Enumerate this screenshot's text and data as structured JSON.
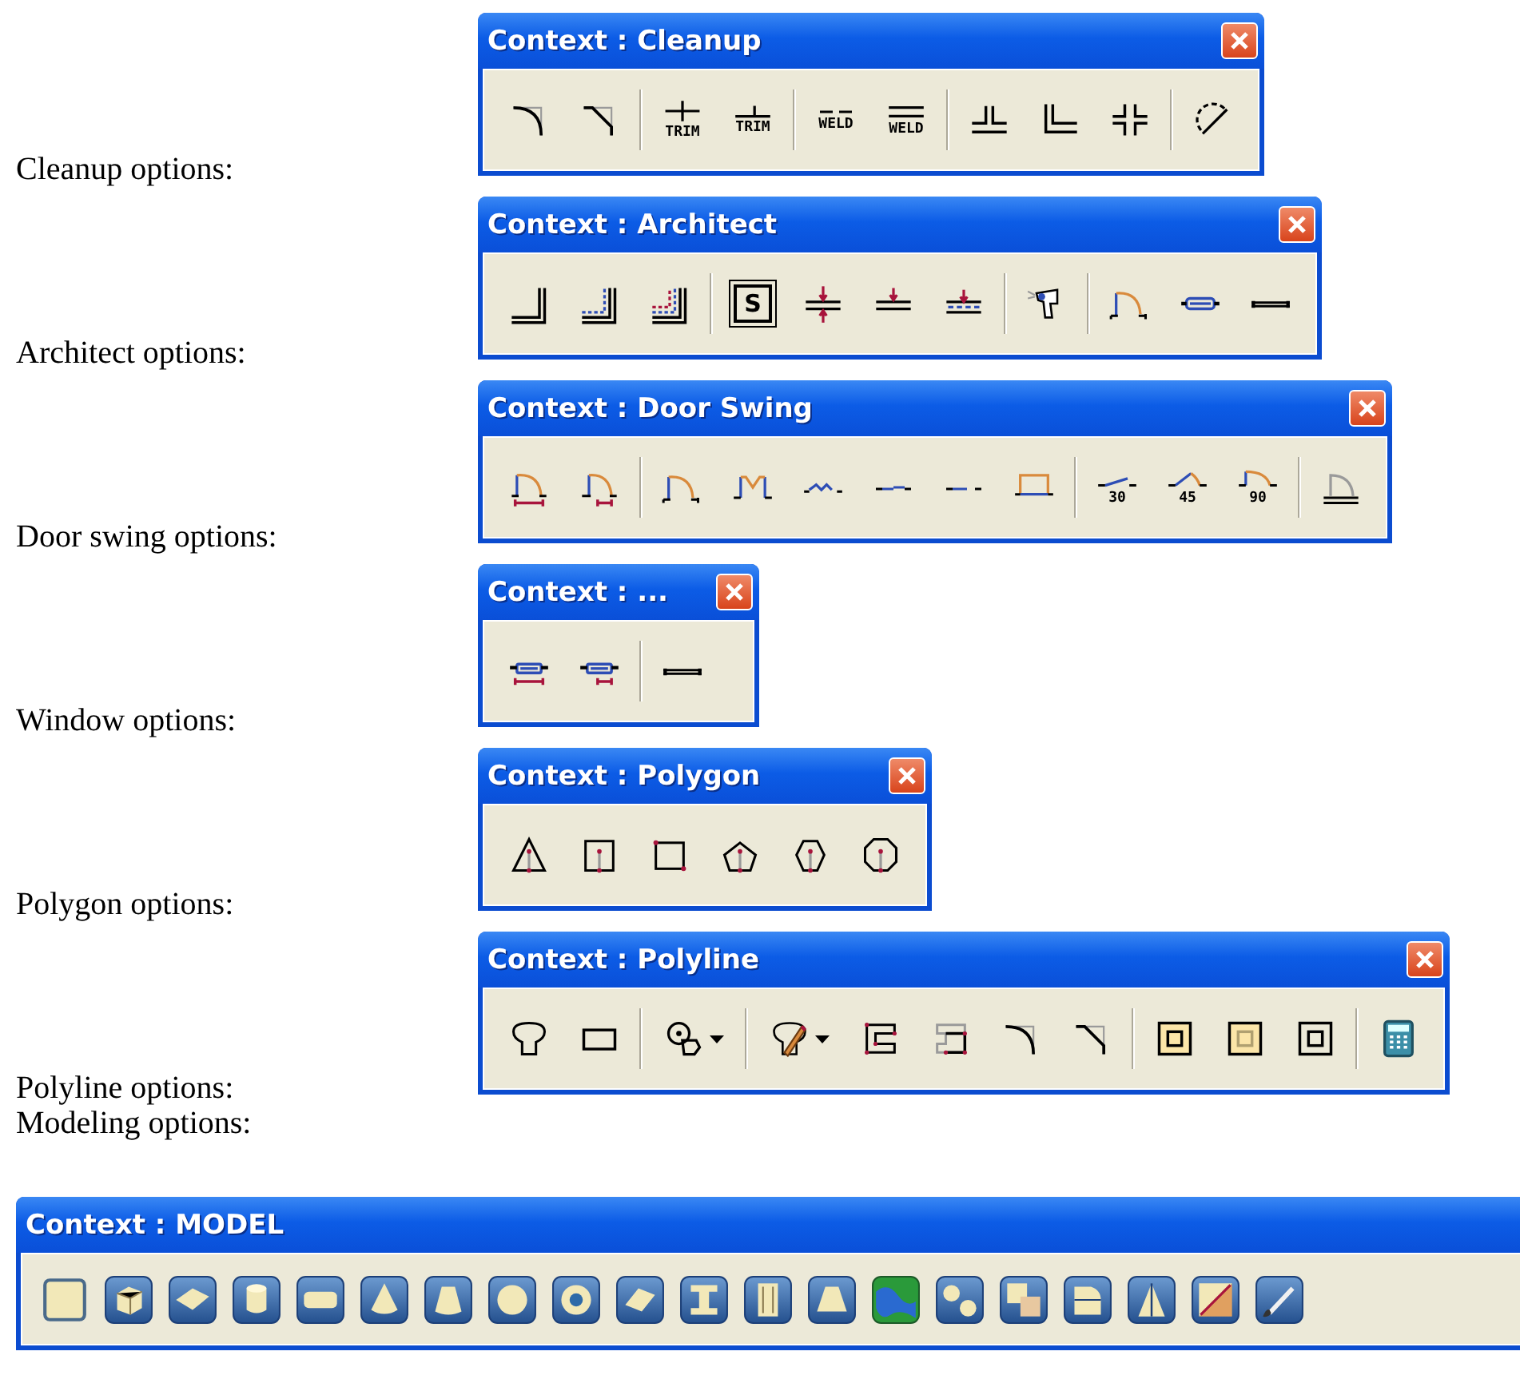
{
  "sections": [
    {
      "kind": "side",
      "label": "Cleanup options:",
      "toolbar": {
        "title": "Context : Cleanup",
        "close_button": true,
        "groups": [
          [
            {
              "kind": "fillet"
            },
            {
              "kind": "chamfer"
            }
          ],
          [
            {
              "kind": "trim-cross",
              "caption": "TRIM"
            },
            {
              "kind": "trim-tee",
              "caption": "TRIM"
            }
          ],
          [
            {
              "kind": "weld-split",
              "caption": "WELD"
            },
            {
              "kind": "weld-double",
              "caption": "WELD"
            }
          ],
          [
            {
              "kind": "wall-tee"
            },
            {
              "kind": "wall-corner"
            },
            {
              "kind": "wall-cross"
            }
          ],
          [
            {
              "kind": "dashed-arc"
            }
          ]
        ]
      }
    },
    {
      "kind": "side",
      "label": "Architect options:",
      "toolbar": {
        "title": "Context : Architect",
        "close_button": true,
        "groups": [
          [
            {
              "kind": "wall-l"
            },
            {
              "kind": "wall-l-dashed"
            },
            {
              "kind": "wall-l-layered"
            }
          ],
          [
            {
              "kind": "boxed-letter",
              "glyph": "S"
            },
            {
              "kind": "wall-arrows"
            },
            {
              "kind": "wall-arrow"
            },
            {
              "kind": "wall-arrow-dashed"
            }
          ],
          [
            {
              "kind": "spray-gun"
            }
          ],
          [
            {
              "kind": "door-arc"
            },
            {
              "kind": "window-opening"
            },
            {
              "kind": "wall-opening"
            }
          ]
        ]
      }
    },
    {
      "kind": "side",
      "label": "Door swing options:",
      "toolbar": {
        "title": "Context : Door Swing",
        "close_button": true,
        "groups": [
          [
            {
              "kind": "door-dim-full"
            },
            {
              "kind": "door-dim-half"
            }
          ],
          [
            {
              "kind": "door-arc"
            },
            {
              "kind": "double-door"
            },
            {
              "kind": "folding-door"
            },
            {
              "kind": "sliding-door"
            },
            {
              "kind": "door-opening"
            },
            {
              "kind": "garage-door"
            }
          ],
          [
            {
              "kind": "door-angle-30",
              "caption": "30"
            },
            {
              "kind": "door-angle-45",
              "caption": "45"
            },
            {
              "kind": "door-angle-90",
              "caption": "90"
            }
          ],
          [
            {
              "kind": "door-threshold"
            }
          ]
        ]
      }
    },
    {
      "kind": "side",
      "label": "Window options:",
      "toolbar": {
        "title": "Context : ...",
        "close_button": true,
        "groups": [
          [
            {
              "kind": "window-dim-full"
            },
            {
              "kind": "window-dim-half"
            }
          ],
          [
            {
              "kind": "wall-opening"
            }
          ]
        ]
      }
    },
    {
      "kind": "side",
      "label": "Polygon options:",
      "toolbar": {
        "title": "Context : Polygon",
        "close_button": true,
        "groups": [
          [
            {
              "kind": "poly-triangle"
            },
            {
              "kind": "poly-square"
            },
            {
              "kind": "poly-square-corner"
            },
            {
              "kind": "poly-pentagon"
            },
            {
              "kind": "poly-hexagon"
            },
            {
              "kind": "poly-octagon"
            }
          ]
        ]
      }
    },
    {
      "kind": "side",
      "label": "Polyline options:",
      "toolbar": {
        "title": "Context : Polyline",
        "close_button": true,
        "groups": [
          [
            {
              "kind": "rounded-outline"
            },
            {
              "kind": "rectangle"
            }
          ],
          [
            {
              "kind": "overlapping-shapes",
              "menu": true
            }
          ],
          [
            {
              "kind": "pencil-outline",
              "menu": true
            },
            {
              "kind": "bracket-shape"
            },
            {
              "kind": "bracket-shape-faded"
            },
            {
              "kind": "fillet"
            },
            {
              "kind": "chamfer"
            }
          ],
          [
            {
              "kind": "nested-squares"
            },
            {
              "kind": "nested-squares-faded"
            },
            {
              "kind": "nested-squares-plain"
            }
          ],
          [
            {
              "kind": "calculator"
            }
          ]
        ]
      }
    },
    {
      "kind": "stacked",
      "label": "Modeling options:",
      "toolbar": {
        "title": "Context : MODEL",
        "close_button": false,
        "groups": [
          [
            {
              "kind": "plane"
            },
            {
              "kind": "cube"
            },
            {
              "kind": "slab"
            },
            {
              "kind": "cylinder"
            },
            {
              "kind": "h-cylinder"
            },
            {
              "kind": "cone"
            },
            {
              "kind": "frustum"
            },
            {
              "kind": "sphere"
            },
            {
              "kind": "torus"
            },
            {
              "kind": "sheet"
            },
            {
              "kind": "i-beam"
            },
            {
              "kind": "column"
            },
            {
              "kind": "pyramid-frustum"
            },
            {
              "kind": "terrain"
            },
            {
              "kind": "spheres"
            },
            {
              "kind": "boolean"
            },
            {
              "kind": "profile"
            },
            {
              "kind": "revolve"
            },
            {
              "kind": "extrude"
            },
            {
              "kind": "paintbrush"
            }
          ]
        ]
      }
    }
  ]
}
